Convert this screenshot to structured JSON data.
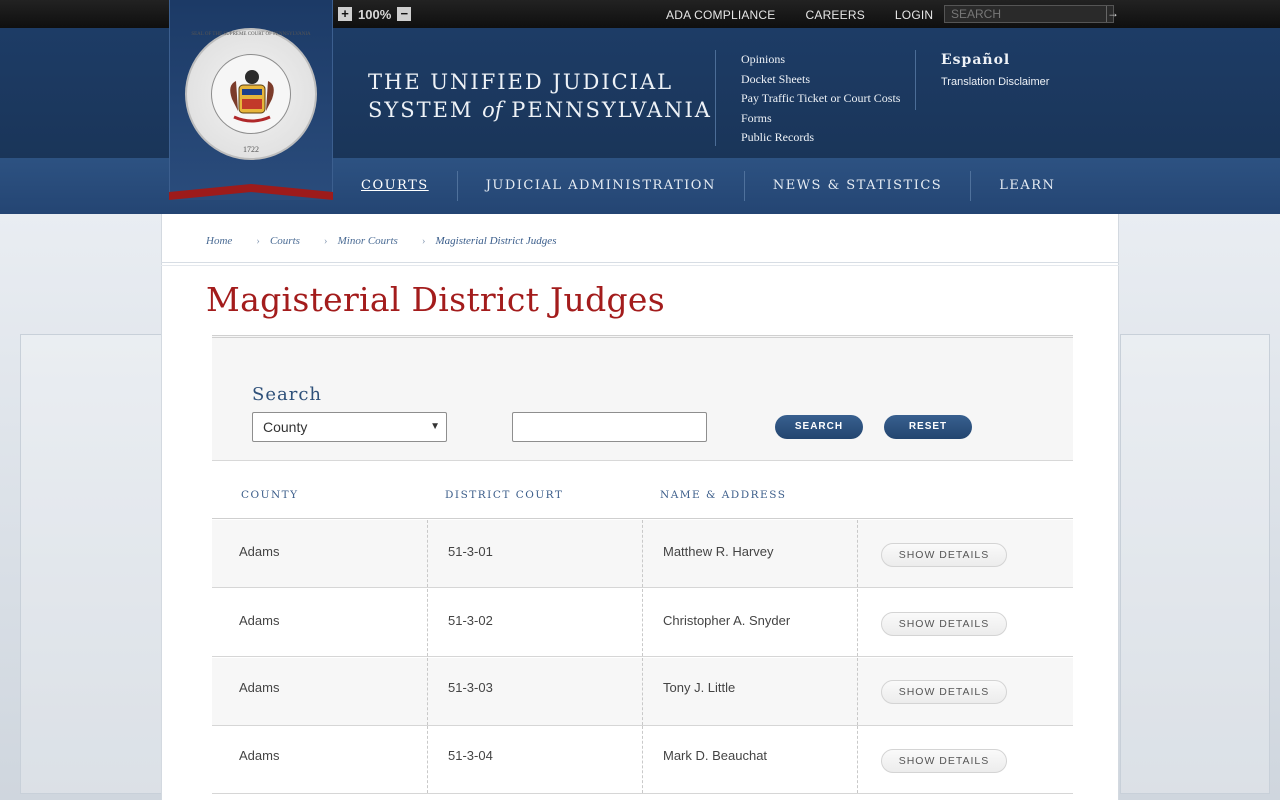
{
  "zoom": {
    "level": "100%",
    "plus": "+",
    "minus": "−"
  },
  "top_links": [
    "ADA COMPLIANCE",
    "CAREERS",
    "LOGIN"
  ],
  "top_search": {
    "placeholder": "SEARCH",
    "button": "→"
  },
  "seal": {
    "ring_text": "SEAL OF THE SUPREME COURT OF PENNSYLVANIA",
    "year": "1722"
  },
  "site_title": {
    "line1": "THE UNIFIED JUDICIAL",
    "line2_pre": "SYSTEM ",
    "line2_of": "of",
    "line2_post": " PENNSYLVANIA"
  },
  "quick_links": [
    "Opinions",
    "Docket Sheets",
    "Pay Traffic Ticket or Court Costs",
    "Forms",
    "Public Records"
  ],
  "language": {
    "espanol": "Español",
    "disclaimer": "Translation Disclaimer"
  },
  "nav": [
    "COURTS",
    "JUDICIAL ADMINISTRATION",
    "NEWS & STATISTICS",
    "LEARN"
  ],
  "breadcrumb": [
    "Home",
    "Courts",
    "Minor Courts",
    "Magisterial District Judges"
  ],
  "page_title": "Magisterial District Judges",
  "search": {
    "label": "Search",
    "select_value": "County",
    "text_value": "",
    "search_button": "SEARCH",
    "reset_button": "RESET"
  },
  "table": {
    "headers": [
      "COUNTY",
      "DISTRICT COURT",
      "NAME & ADDRESS"
    ],
    "rows": [
      {
        "county": "Adams",
        "court": "51-3-01",
        "name": "Matthew R. Harvey",
        "action": "SHOW DETAILS"
      },
      {
        "county": "Adams",
        "court": "51-3-02",
        "name": "Christopher A. Snyder",
        "action": "SHOW DETAILS"
      },
      {
        "county": "Adams",
        "court": "51-3-03",
        "name": "Tony J. Little",
        "action": "SHOW DETAILS"
      },
      {
        "county": "Adams",
        "court": "51-3-04",
        "name": "Mark D. Beauchat",
        "action": "SHOW DETAILS"
      }
    ]
  },
  "colors": {
    "header_blue": "#1d3c66",
    "nav_blue": "#2d5282",
    "title_red": "#a31c1c",
    "banner_red": "#9d1b1b",
    "link_blue": "#3b5d8a"
  }
}
